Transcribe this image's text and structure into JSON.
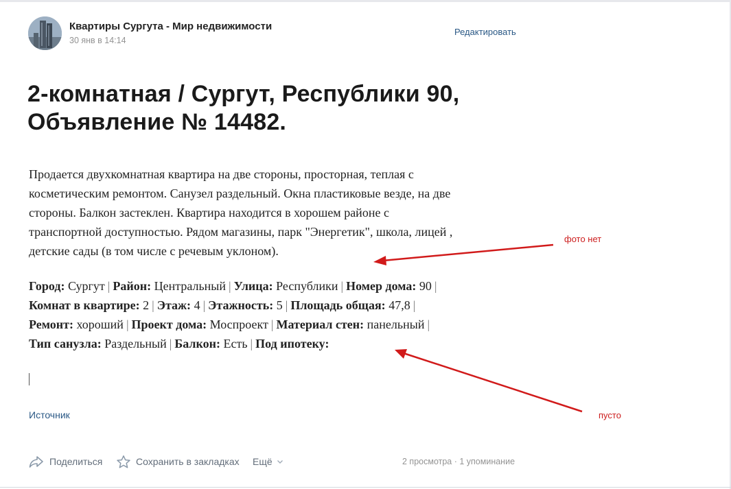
{
  "post": {
    "author": "Квартиры Сургута - Мир недвижимости",
    "date": "30 янв в 14:14",
    "edit_label": "Редактировать",
    "title_line1": "2-комнатная / Сургут, Республики 90,",
    "title_line2": "Объявление № 14482.",
    "description_lines": [
      "Продается двухкомнатная квартира на две стороны, просторная, теплая с",
      "косметическим ремонтом. Санузел раздельный. Окна пластиковые везде, на две",
      "стороны. Балкон застеклен. Квартира находится в хорошем районе с",
      "транспортной доступностью. Рядом магазины, парк \"Энергетик\", школа, лицей ,",
      "детские сады (в том числе с речевым уклоном)."
    ],
    "properties": {
      "city_label": "Город:",
      "city": "Сургут",
      "district_label": "Район:",
      "district": "Центральный",
      "street_label": "Улица:",
      "street": "Республики",
      "house_label": "Номер дома:",
      "house": "90",
      "rooms_label": "Комнат в квартире:",
      "rooms": "2",
      "floor_label": "Этаж:",
      "floor": "4",
      "floors_label": "Этажность:",
      "floors": "5",
      "area_label": "Площадь общая:",
      "area": "47,8",
      "repair_label": "Ремонт:",
      "repair": "хороший",
      "project_label": "Проект дома:",
      "project": "Моспроект",
      "walls_label": "Материал стен:",
      "walls": "панельный",
      "bath_label": "Тип санузла:",
      "bath": "Раздельный",
      "balcony_label": "Балкон:",
      "balcony": "Есть",
      "mortgage_label": "Под ипотеку:",
      "separator": "|"
    },
    "caret_symbol": "|",
    "source_label": "Источник"
  },
  "actions": {
    "share_label": "Поделиться",
    "save_label": "Сохранить в закладках",
    "more_label": "Ещё"
  },
  "stats": "2 просмотра · 1 упоминание",
  "annotations": {
    "no_photo": "фото нет",
    "empty": "пусто",
    "arrow_color": "#d11a1a"
  },
  "colors": {
    "link": "#2a5885",
    "muted": "#939393",
    "action": "#626d7a"
  },
  "icons": {
    "share": "share-arrow-icon",
    "save": "star-outline-icon",
    "more": "chevron-down-icon"
  }
}
